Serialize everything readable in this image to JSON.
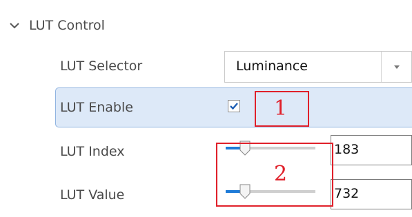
{
  "section": {
    "title": "LUT Control",
    "icon": "chevron-down-icon",
    "expanded": true
  },
  "rows": {
    "selector": {
      "label": "LUT Selector",
      "value": "Luminance",
      "icon": "dropdown-arrow-icon"
    },
    "enable": {
      "label": "LUT Enable",
      "checked": true,
      "icon": "checkmark-icon"
    },
    "index": {
      "label": "LUT Index",
      "value": "183",
      "slider_fraction": 0.12
    },
    "value": {
      "label": "LUT Value",
      "value": "732",
      "slider_fraction": 0.12
    }
  },
  "annotations": [
    {
      "number": "1"
    },
    {
      "number": "2"
    }
  ],
  "colors": {
    "highlight_bg": "#dde9f8",
    "highlight_border": "#8fb3e0",
    "accent": "#1e7bd8",
    "annotation": "#e0202a"
  }
}
